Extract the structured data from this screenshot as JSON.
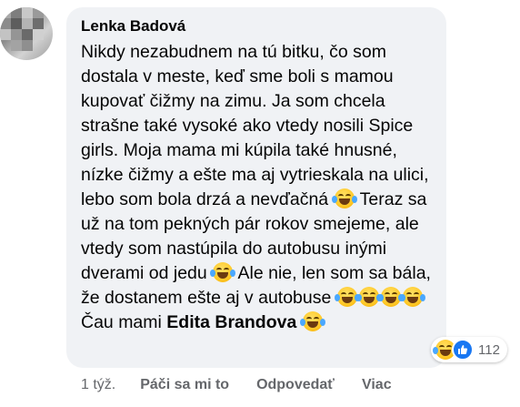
{
  "comment": {
    "author": "Lenka Badová",
    "body_segments": [
      "Nikdy nezabudnem na tú bitku, čo som dostala v meste, keď sme boli s mamou kupovať čižmy na zimu. Ja som chcela strašne také vysoké ako vtedy nosili Spice girls. Moja mama mi kúpila také hnusné, nízke čižmy a ešte ma aj vytrieskala na ulici, lebo som bola drzá a nevďačná",
      "Teraz sa už na tom pekných pár rokov smejeme, ale vtedy som nastúpila do autobusu inými dverami od jedu",
      "Ale nie, len som sa bála, že dostanem ešte aj v autobuse",
      "Čau mami"
    ],
    "mention": "Edita Brandova",
    "emoji_name": "face-with-tears-of-joy-icon"
  },
  "reactions": {
    "icons": [
      "face-with-tears-of-joy-icon",
      "like-icon"
    ],
    "count": "112"
  },
  "actions": {
    "timestamp": "1 týž.",
    "like_label": "Páči sa mi to",
    "reply_label": "Odpovedať",
    "more_label": "Viac"
  },
  "colors": {
    "bubble_bg": "#f0f2f5",
    "text": "#050505",
    "meta_text": "#65676b",
    "like_blue": "#1877f2",
    "emoji_yellow": "#ffc928"
  }
}
